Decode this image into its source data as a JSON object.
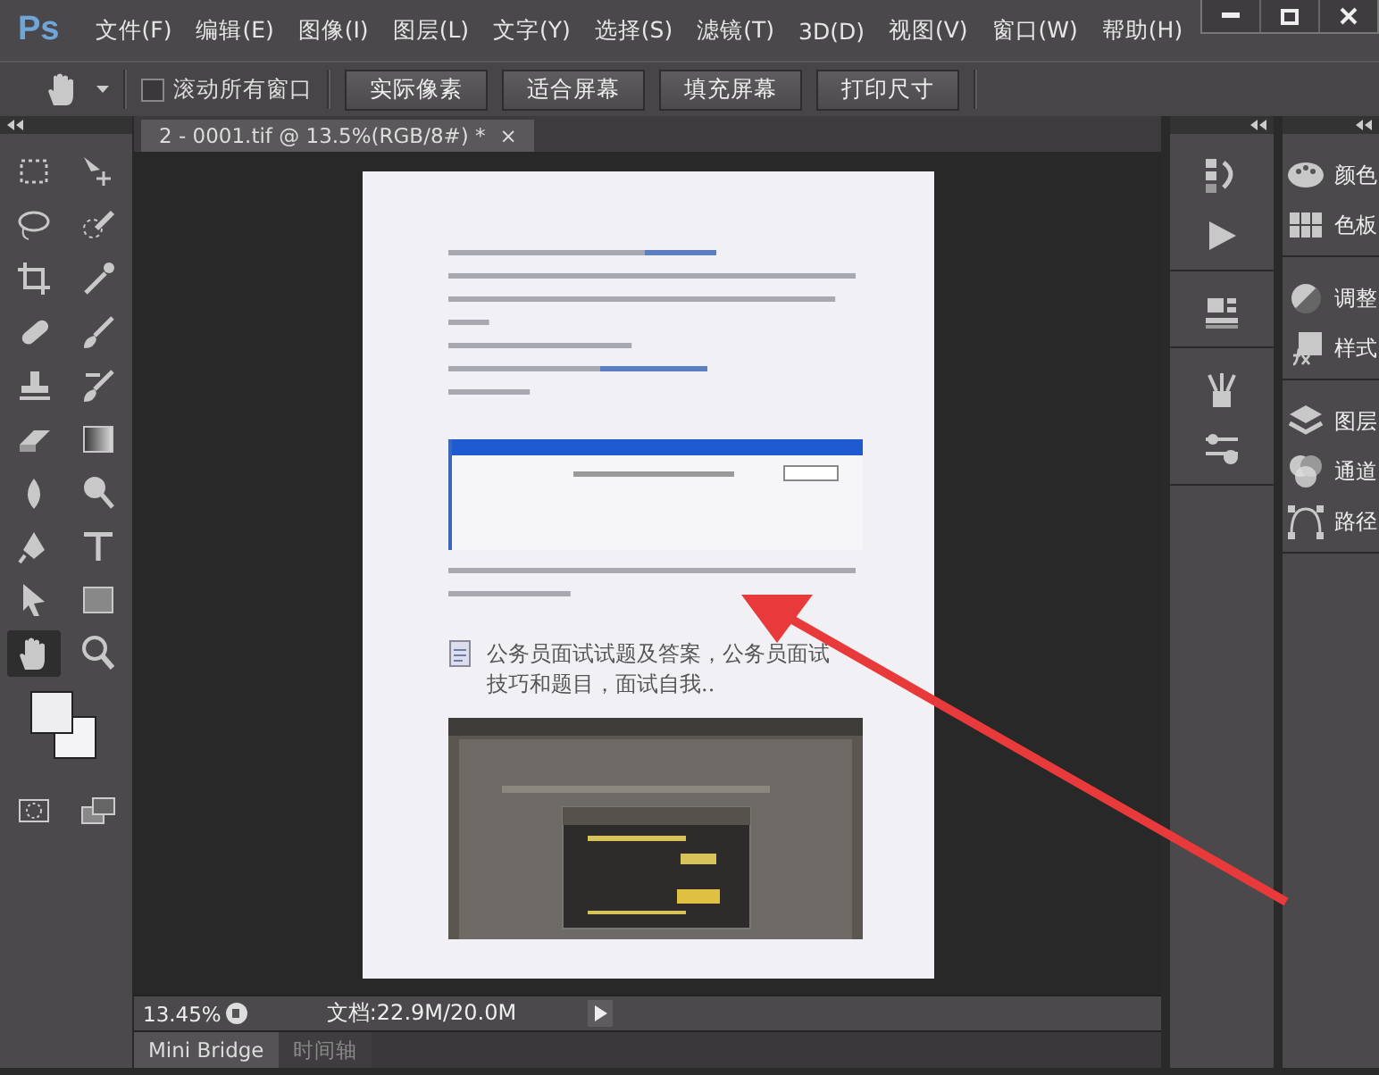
{
  "app_logo": "Ps",
  "menu": [
    "文件(F)",
    "编辑(E)",
    "图像(I)",
    "图层(L)",
    "文字(Y)",
    "选择(S)",
    "滤镜(T)",
    "3D(D)",
    "视图(V)",
    "窗口(W)",
    "帮助(H)"
  ],
  "options_bar": {
    "scroll_all": {
      "label": "滚动所有窗口",
      "checked": false
    },
    "buttons": [
      "实际像素",
      "适合屏幕",
      "填充屏幕",
      "打印尺寸"
    ]
  },
  "tools": [
    {
      "kind": "marquee",
      "selected": false
    },
    {
      "kind": "move",
      "selected": false
    },
    {
      "kind": "lasso",
      "selected": false
    },
    {
      "kind": "quick-select",
      "selected": false
    },
    {
      "kind": "crop",
      "selected": false
    },
    {
      "kind": "eyedropper",
      "selected": false
    },
    {
      "kind": "healing",
      "selected": false
    },
    {
      "kind": "brush",
      "selected": false
    },
    {
      "kind": "stamp",
      "selected": false
    },
    {
      "kind": "history-brush",
      "selected": false
    },
    {
      "kind": "eraser",
      "selected": false
    },
    {
      "kind": "gradient",
      "selected": false
    },
    {
      "kind": "blur",
      "selected": false
    },
    {
      "kind": "dodge",
      "selected": false
    },
    {
      "kind": "pen",
      "selected": false
    },
    {
      "kind": "type",
      "selected": false
    },
    {
      "kind": "path-select",
      "selected": false
    },
    {
      "kind": "shape",
      "selected": false
    },
    {
      "kind": "hand",
      "selected": true
    },
    {
      "kind": "zoom",
      "selected": false
    }
  ],
  "document_tab": {
    "title": "2 - 0001.tif @ 13.5%(RGB/8#) *",
    "close": "×",
    "selected": true
  },
  "document": {
    "heading": "公务员面试试题及答案，公务员面试技巧和题目，面试自我.."
  },
  "status_bar": {
    "zoom": "13.45%",
    "info": "文档:22.9M/20.0M"
  },
  "bottom_tabs": [
    {
      "label": "Mini Bridge",
      "selected": true
    },
    {
      "label": "时间轴",
      "selected": false
    }
  ],
  "icon_dock": [
    [
      {
        "kind": "history"
      },
      {
        "kind": "actions"
      }
    ],
    [
      {
        "kind": "properties"
      }
    ],
    [
      {
        "kind": "brush-presets"
      },
      {
        "kind": "adjust-sliders"
      }
    ]
  ],
  "panels": [
    [
      {
        "kind": "color",
        "label": "颜色"
      },
      {
        "kind": "swatches",
        "label": "色板"
      }
    ],
    [
      {
        "kind": "adjustments",
        "label": "调整"
      },
      {
        "kind": "styles",
        "label": "样式"
      }
    ],
    [
      {
        "kind": "layers",
        "label": "图层"
      },
      {
        "kind": "channels",
        "label": "通道"
      },
      {
        "kind": "paths",
        "label": "路径"
      }
    ]
  ]
}
